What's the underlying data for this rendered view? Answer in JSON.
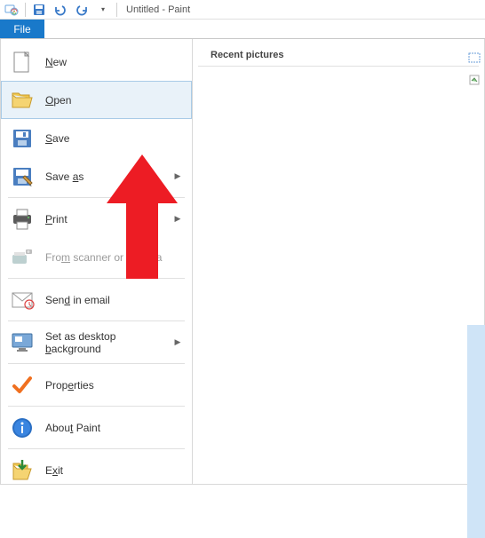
{
  "titlebar": {
    "title": "Untitled - Paint"
  },
  "tabs": {
    "file": "File"
  },
  "menu": {
    "new": "New",
    "open": "Open",
    "save": "Save",
    "save_as": "Save as",
    "print": "Print",
    "from_scanner": "From scanner or camera",
    "send_email": "Send in email",
    "set_bg": "Set as desktop background",
    "properties": "Properties",
    "about": "About Paint",
    "exit": "Exit",
    "new_u": "N",
    "open_u": "O",
    "save_u": "S",
    "save_as_u": "a",
    "print_u": "P",
    "from_u": "m",
    "email_u": "d",
    "bg_u": "b",
    "prop_u": "e",
    "about_u": "t",
    "exit_u": "x"
  },
  "right": {
    "recent": "Recent pictures"
  }
}
